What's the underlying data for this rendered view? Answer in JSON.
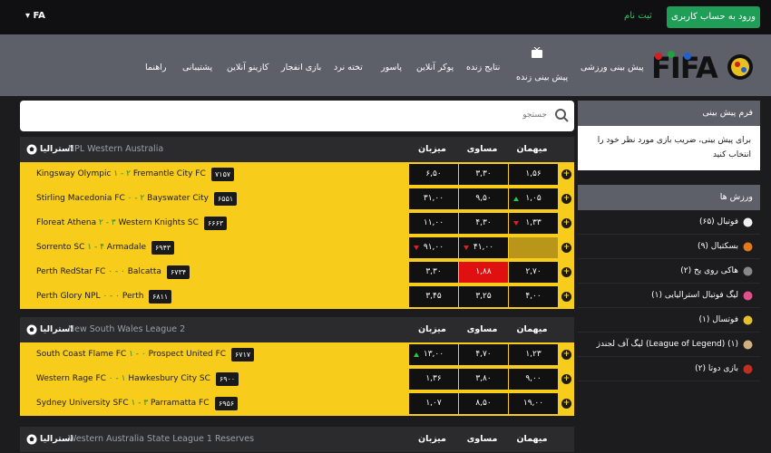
{
  "topbar": {
    "lang": "▾ FA",
    "login": "ورود به حساب کاربری",
    "signup": "ثبت نام"
  },
  "nav": {
    "logo": "FIFA90",
    "items": [
      "پیش بینی ورزشی",
      "پیش بینی زنده",
      "نتایج زنده",
      "پوکر آنلاین",
      "پاسور",
      "تخته نرد",
      "بازی انفجار",
      "کازینو آنلاین",
      "پشتیبانی",
      "راهنما"
    ]
  },
  "search": {
    "placeholder": "جستجو"
  },
  "columns": {
    "home": "میهمان",
    "draw": "مساوی",
    "away": "میزبان"
  },
  "leagues": [
    {
      "country": "استرالیا",
      "name": "NPL Western Australia",
      "matches": [
        {
          "home": "Kingsway Olympic",
          "score": "۱ - ۲",
          "away": "Fremantle City FC",
          "id": "۷۱۵۷",
          "o1": "۶,۵۰",
          "ox": "۳,۳۰",
          "o2": "۱,۵۶"
        },
        {
          "home": "Stirling Macedonia FC",
          "score": "۰ - ۲",
          "away": "Bayswater City",
          "id": "۶۵۵۱",
          "o1": "۳۱,۰۰",
          "ox": "۹,۵۰",
          "o2": "۱,۰۵",
          "t2": "up"
        },
        {
          "home": "Floreat Athena",
          "score": "۲ - ۳",
          "away": "Western Knights SC",
          "id": "۶۶۶۳",
          "o1": "۱۱,۰۰",
          "ox": "۴,۳۰",
          "o2": "۱,۳۳",
          "t2": "dn"
        },
        {
          "home": "Sorrento SC",
          "score": "۱ - ۴",
          "away": "Armadale",
          "id": "۶۹۴۳",
          "o1": "۹۱,۰۰",
          "ox": "۴۱,۰۰",
          "o2": "",
          "t1": "dn",
          "tx": "dn",
          "dis2": true
        },
        {
          "home": "Perth RedStar FC",
          "score": "۰ - ۰",
          "away": "Balcatta",
          "id": "۶۷۳۴",
          "o1": "۳,۳۰",
          "ox": "۱,۸۸",
          "o2": "۲,۷۰",
          "redx": true
        },
        {
          "home": "Perth Glory NPL",
          "score": "۰ - ۰",
          "away": "Perth",
          "id": "۶۸۱۱",
          "o1": "۳,۴۵",
          "ox": "۳,۲۵",
          "o2": "۴,۰۰"
        }
      ]
    },
    {
      "country": "استرالیا",
      "name": "New South Wales League 2",
      "matches": [
        {
          "home": "South Coast Flame FC",
          "score": "۱ - ۰",
          "away": "Prospect United FC",
          "id": "۶۷۱۷",
          "o1": "۱۳,۰۰",
          "ox": "۴,۷۰",
          "o2": "۱,۲۳",
          "t1": "up"
        },
        {
          "home": "Western Rage FC",
          "score": "۰ - ۱",
          "away": "Hawkesbury City SC",
          "id": "۶۹۰۰",
          "o1": "۱,۳۶",
          "ox": "۳,۸۰",
          "o2": "۹,۰۰"
        },
        {
          "home": "Sydney University SFC",
          "score": "۱ - ۳",
          "away": "Parramatta FC",
          "id": "۶۹۵۶",
          "o1": "۱,۰۷",
          "ox": "۸,۵۰",
          "o2": "۱۹,۰۰"
        }
      ]
    },
    {
      "country": "استرالیا",
      "name": "Western Australia State League 1 Reserves",
      "matches": []
    }
  ],
  "sidebar": {
    "form_title": "فرم پیش بینی",
    "form_text": "برای پیش بینی، ضریب بازی مورد نظر خود را انتخاب کنید",
    "sports_title": "ورزش ها",
    "sports": [
      "فوتبال (۶۵)",
      "بسکتبال (۹)",
      "هاکی روی یخ (۲)",
      "لیگ فوتبال استرالیایی (۱)",
      "فوتسال (۱)",
      "لیگ آف لجندز (League of Legend) (۱)",
      "بازی دوتا (۲)"
    ],
    "colors": [
      "#f0f0f0",
      "#e07a20",
      "#888888",
      "#e0508a",
      "#e0c030",
      "#d0b080",
      "#c03020"
    ]
  }
}
